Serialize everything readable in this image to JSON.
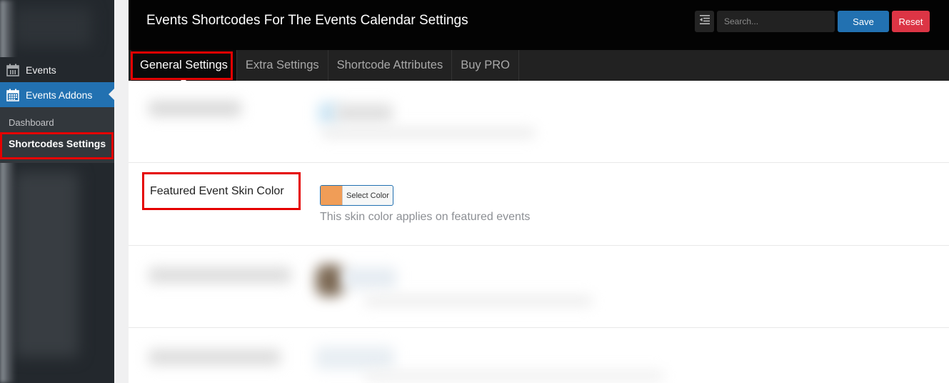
{
  "sidebar": {
    "items": [
      {
        "label": "Events",
        "icon": "calendar-icon",
        "active": false
      },
      {
        "label": "Events Addons",
        "icon": "calendar-grid-icon",
        "active": true
      }
    ],
    "submenu": [
      {
        "label": "Dashboard",
        "current": false
      },
      {
        "label": "Shortcodes Settings",
        "current": true
      }
    ]
  },
  "header": {
    "title": "Events Shortcodes For The Events Calendar Settings",
    "search_placeholder": "Search...",
    "save_label": "Save",
    "reset_label": "Reset",
    "toggle_icon": "collapse-menu-icon"
  },
  "tabs": [
    {
      "label": "General Settings",
      "active": true
    },
    {
      "label": "Extra Settings",
      "active": false
    },
    {
      "label": "Shortcode Attributes",
      "active": false
    },
    {
      "label": "Buy PRO",
      "active": false
    }
  ],
  "settings": {
    "featured_skin": {
      "label": "Featured Event Skin Color",
      "button_label": "Select Color",
      "value_color": "#f09d57",
      "description": "This skin color applies on featured events"
    }
  },
  "colors": {
    "accent": "#2271b1",
    "danger": "#dc3545",
    "highlight": "#e50000"
  }
}
